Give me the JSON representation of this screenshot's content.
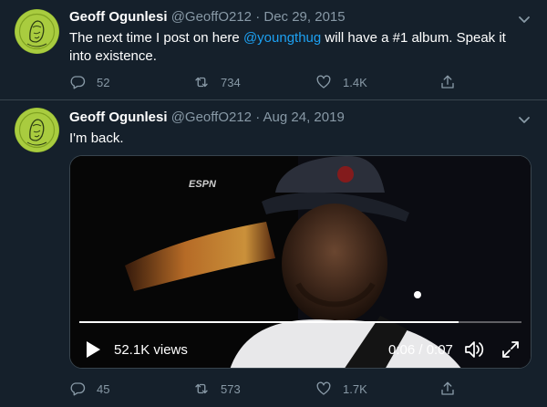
{
  "tweets": [
    {
      "author_name": "Geoff Ogunlesi",
      "handle": "@GeoffO212",
      "separator": "·",
      "date": "Dec 29, 2015",
      "text_before": "The next time I post on here ",
      "mention": "@youngthug",
      "text_after": " will have a #1 album. Speak it into existence.",
      "replies": "52",
      "retweets": "734",
      "likes": "1.4K"
    },
    {
      "author_name": "Geoff Ogunlesi",
      "handle": "@GeoffO212",
      "separator": "·",
      "date": "Aug 24, 2019",
      "text": "I'm back.",
      "video": {
        "views": "52.1K views",
        "time": "0:06 / 0:07",
        "progress": 0.857,
        "watermark": "ESPN"
      },
      "replies": "45",
      "retweets": "573",
      "likes": "1.7K"
    }
  ],
  "colors": {
    "background": "#15202b",
    "accent": "#1da1f2",
    "muted": "#8899a6",
    "border": "#38444d"
  },
  "icons": {
    "caret": "chevron-down-icon",
    "reply": "reply-icon",
    "retweet": "retweet-icon",
    "like": "heart-icon",
    "share": "share-icon",
    "play": "play-icon",
    "volume": "volume-icon",
    "expand": "expand-icon"
  }
}
